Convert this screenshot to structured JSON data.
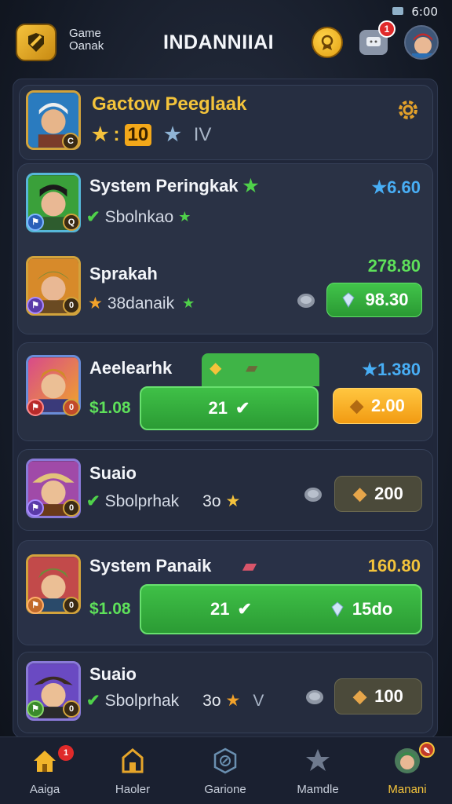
{
  "status": {
    "time": "6:00"
  },
  "header": {
    "brand_line1": "Game",
    "brand_line2": "Oanak",
    "title": "INDANNIIAI",
    "notification_count": "1"
  },
  "profile": {
    "name": "Gactow Peeglaak",
    "level": "10",
    "rank_text": "IV",
    "star_prefix": ":"
  },
  "items": [
    {
      "name": "System Peringkak",
      "sub": "Sbolnkao",
      "value": "6.60",
      "value_color": "blue",
      "badge": "Q"
    },
    {
      "name": "Sprakah",
      "sub": "38danaik",
      "value": "278.80",
      "value_color": "green",
      "button": "98.30",
      "badge": "0"
    },
    {
      "name": "Aeelearhk",
      "sub": "$1.08",
      "value": "1.380",
      "value_color": "blue",
      "main_button": "21",
      "side_button": "2.00",
      "badge": "0"
    },
    {
      "name": "Suaio",
      "sub": "Sbolprhak",
      "count": "3o",
      "button": "200",
      "badge": "0"
    },
    {
      "name": "System Panaik",
      "sub": "$1.08",
      "value": "160.80",
      "value_color": "gold",
      "main_button": "21",
      "main_button_right": "15do",
      "badge": "0"
    },
    {
      "name": "Suaio",
      "sub": "Sbolprhak",
      "count": "3o",
      "rank_text": "V",
      "button": "100",
      "badge": "0"
    }
  ],
  "nav": [
    {
      "label": "Aaiga",
      "icon": "home-icon",
      "badge": "1"
    },
    {
      "label": "Haoler",
      "icon": "shop-icon"
    },
    {
      "label": "Garione",
      "icon": "compass-icon"
    },
    {
      "label": "Mamdle",
      "icon": "star-badge-icon"
    },
    {
      "label": "Manani",
      "icon": "profile-icon",
      "active": true
    }
  ],
  "colors": {
    "accent_gold": "#f3c33b",
    "accent_green": "#41c44a",
    "accent_blue": "#48aef5",
    "panel": "#20273a"
  }
}
